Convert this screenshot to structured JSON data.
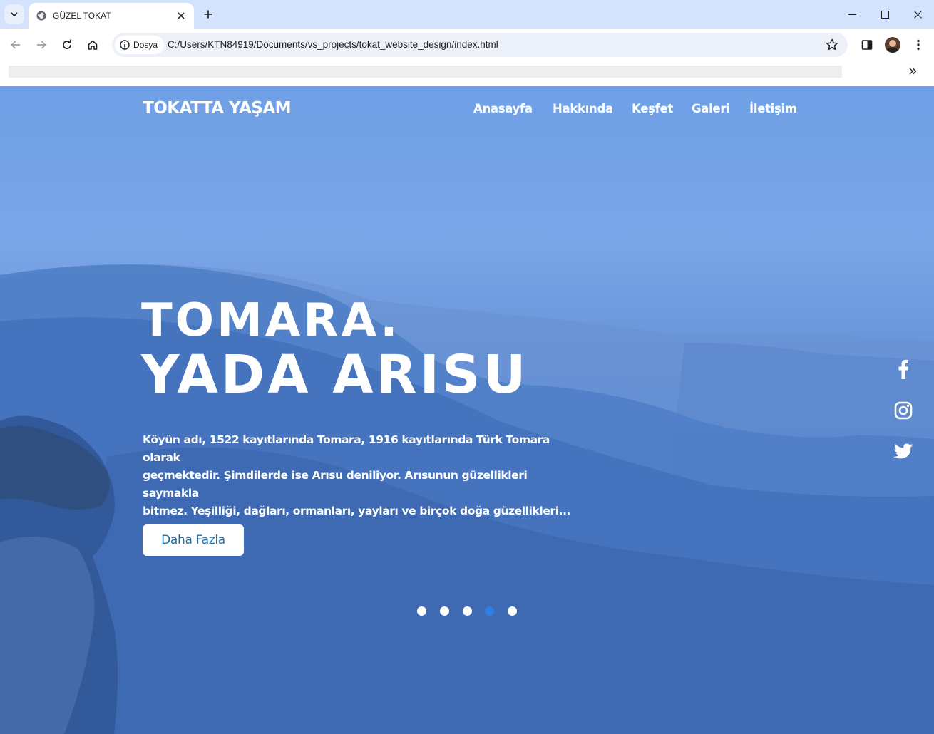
{
  "browser": {
    "tab_title": "GÜZEL TOKAT",
    "security_chip": "Dosya",
    "url": "C:/Users/KTN84919/Documents/vs_projects/tokat_website_design/index.html"
  },
  "site": {
    "brand": "TOKATTA YAŞAM",
    "nav": [
      {
        "label": "Anasayfa"
      },
      {
        "label": "Hakkında"
      },
      {
        "label": "Keşfet"
      },
      {
        "label": "Galeri"
      },
      {
        "label": "İletişim"
      }
    ],
    "hero": {
      "title_line1": "TOMARA.",
      "title_line2": "YADA ARISU",
      "lead_lines": [
        "Köyün adı, 1522 kayıtlarında Tomara, 1916 kayıtlarında Türk Tomara olarak",
        "geçmektedir. Şimdilerde ise Arısu deniliyor. Arısunun güzellikleri saymakla",
        "bitmez. Yeşilliği, dağları, ormanları, yayları ve birçok doğa güzellikleri..."
      ],
      "cta_label": "Daha Fazla"
    },
    "social": [
      "facebook-icon",
      "instagram-icon",
      "twitter-icon"
    ],
    "slider": {
      "count": 5,
      "active_index": 4
    }
  },
  "colors": {
    "tabbar": "#d3e3fd",
    "omnibox": "#ecf1fa",
    "sky": "#6f9fe6",
    "mountain": "#3c6bb6",
    "accent_dot": "#2f7fe0",
    "cta_text": "#1f6fa8"
  }
}
